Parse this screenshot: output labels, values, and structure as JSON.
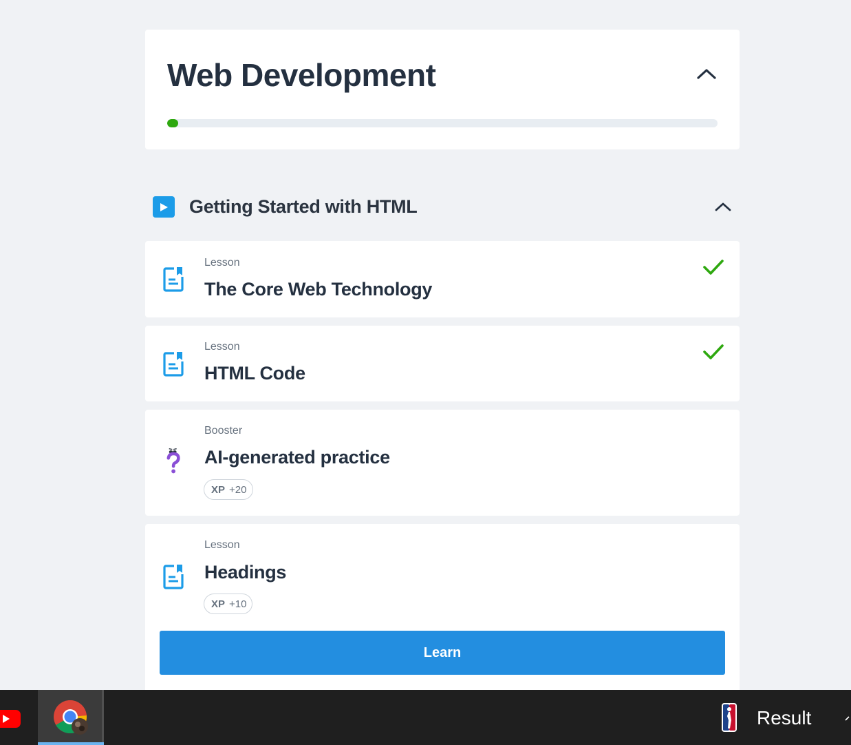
{
  "course": {
    "title": "Web Development",
    "progress_percent": 2,
    "progress_color": "#2ea80f"
  },
  "section": {
    "title": "Getting Started with HTML",
    "icon": "play-icon",
    "accent_color": "#1c9ce8"
  },
  "items": [
    {
      "type": "Lesson",
      "title": "The Core Web Technology",
      "completed": true,
      "icon": "lesson-doc-icon"
    },
    {
      "type": "Lesson",
      "title": "HTML Code",
      "completed": true,
      "icon": "lesson-doc-icon"
    },
    {
      "type": "Booster",
      "title": "AI-generated practice",
      "completed": false,
      "icon": "question-mark-icon",
      "xp_label": "XP",
      "xp_value": "+20"
    },
    {
      "type": "Lesson",
      "title": "Headings",
      "completed": false,
      "icon": "lesson-doc-icon",
      "xp_label": "XP",
      "xp_value": "+10",
      "button_label": "Learn"
    }
  ],
  "taskbar": {
    "apps": [
      "youtube-icon",
      "chrome-icon",
      "nba-icon"
    ],
    "result_label": "Result"
  },
  "colors": {
    "background": "#f0f2f5",
    "check": "#2ea80f",
    "button": "#238ee0",
    "booster": "#8a4fd6"
  }
}
